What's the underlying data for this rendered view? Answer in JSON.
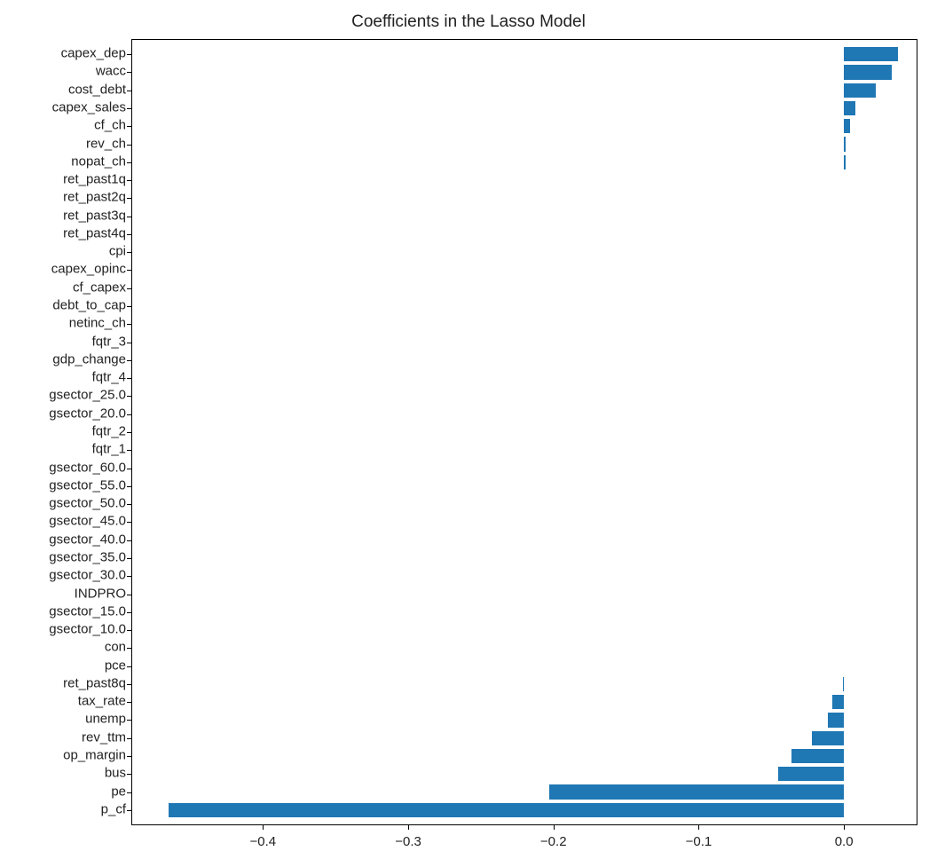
{
  "chart_data": {
    "type": "bar",
    "orientation": "horizontal",
    "title": "Coefficients in the Lasso Model",
    "xlabel": "",
    "ylabel": "",
    "xlim": [
      -0.49,
      0.05
    ],
    "categories": [
      "capex_dep",
      "wacc",
      "cost_debt",
      "capex_sales",
      "cf_ch",
      "rev_ch",
      "nopat_ch",
      "ret_past1q",
      "ret_past2q",
      "ret_past3q",
      "ret_past4q",
      "cpi",
      "capex_opinc",
      "cf_capex",
      "debt_to_cap",
      "netinc_ch",
      "fqtr_3",
      "gdp_change",
      "fqtr_4",
      "gsector_25.0",
      "gsector_20.0",
      "fqtr_2",
      "fqtr_1",
      "gsector_60.0",
      "gsector_55.0",
      "gsector_50.0",
      "gsector_45.0",
      "gsector_40.0",
      "gsector_35.0",
      "gsector_30.0",
      "INDPRO",
      "gsector_15.0",
      "gsector_10.0",
      "con",
      "pce",
      "ret_past8q",
      "tax_rate",
      "unemp",
      "rev_ttm",
      "op_margin",
      "bus",
      "pe",
      "p_cf"
    ],
    "values": [
      0.037,
      0.033,
      0.022,
      0.008,
      0.004,
      0.001,
      0.001,
      0.0,
      0.0,
      0.0,
      0.0,
      0.0,
      0.0,
      0.0,
      0.0,
      0.0,
      0.0,
      0.0,
      0.0,
      0.0,
      0.0,
      0.0,
      0.0,
      0.0,
      0.0,
      0.0,
      0.0,
      0.0,
      0.0,
      0.0,
      0.0,
      0.0,
      0.0,
      0.0,
      0.0,
      -0.001,
      -0.008,
      -0.011,
      -0.022,
      -0.036,
      -0.045,
      -0.203,
      -0.465
    ],
    "x_ticks": [
      -0.4,
      -0.3,
      -0.2,
      -0.1,
      0.0
    ],
    "x_tick_labels": [
      "−0.4",
      "−0.3",
      "−0.2",
      "−0.1",
      "0.0"
    ],
    "bar_color": "#1f77b4"
  }
}
